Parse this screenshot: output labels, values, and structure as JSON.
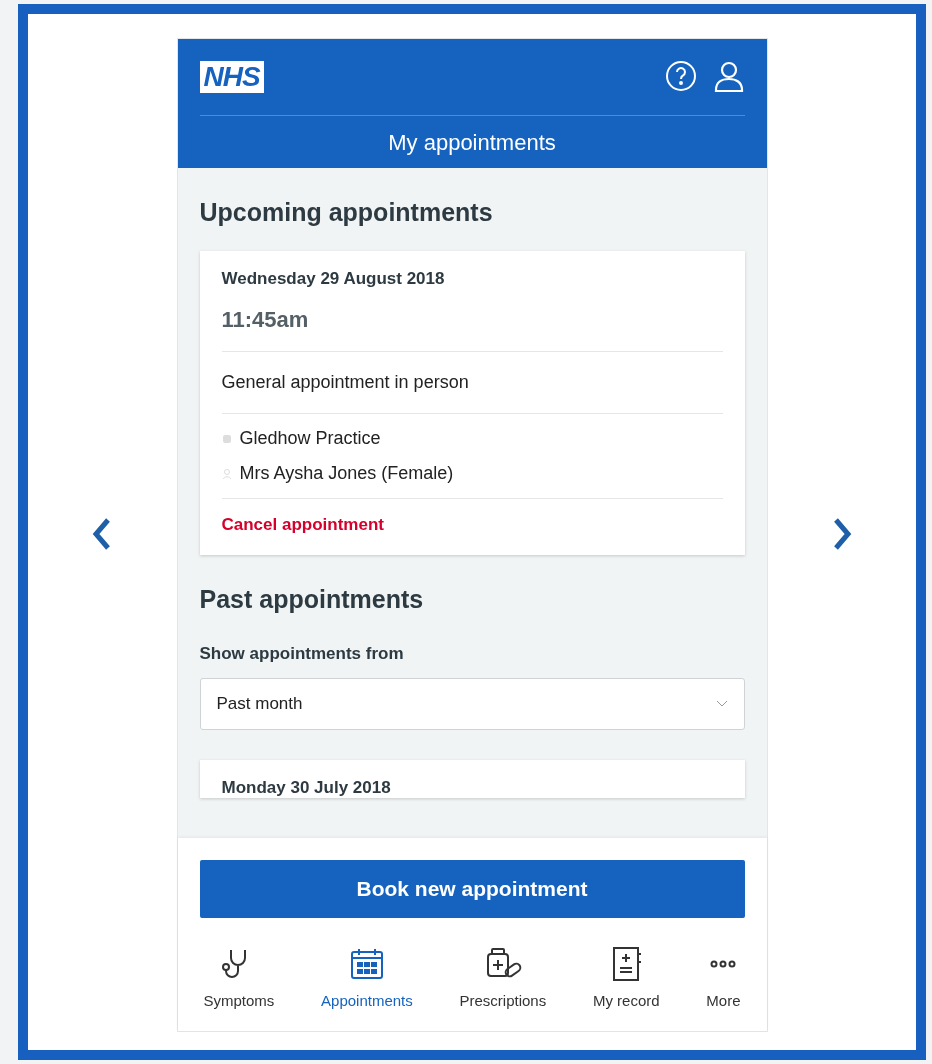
{
  "header": {
    "logo": "NHS",
    "title": "My appointments"
  },
  "upcoming": {
    "heading": "Upcoming appointments",
    "appointments": [
      {
        "date": "Wednesday 29 August 2018",
        "time": "11:45am",
        "type": "General appointment in person",
        "location": "Gledhow Practice",
        "clinician": "Mrs Aysha Jones (Female)",
        "action": "Cancel appointment"
      }
    ]
  },
  "past": {
    "heading": "Past appointments",
    "filter_label": "Show appointments from",
    "filter_value": "Past month",
    "first_date": "Monday 30 July 2018"
  },
  "book_button": "Book new appointment",
  "nav": [
    {
      "label": "Symptoms",
      "kind": "stethoscope",
      "selected": false
    },
    {
      "label": "Appointments",
      "kind": "calendar",
      "selected": true
    },
    {
      "label": "Prescriptions",
      "kind": "medicine",
      "selected": false
    },
    {
      "label": "My record",
      "kind": "record",
      "selected": false
    },
    {
      "label": "More",
      "kind": "more",
      "selected": false
    }
  ]
}
